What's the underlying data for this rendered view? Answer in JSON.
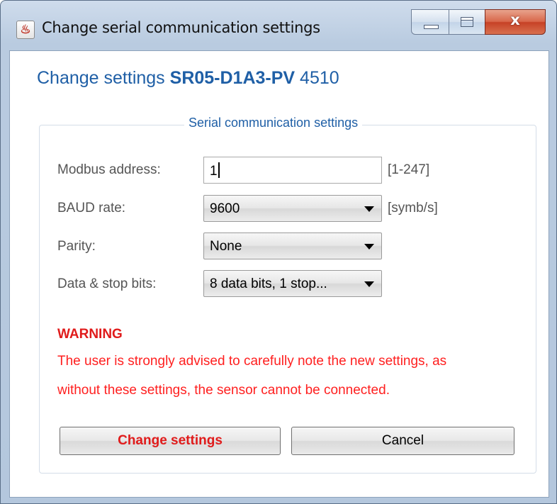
{
  "window": {
    "title": "Change serial communication settings",
    "app_icon": "java-icon",
    "close_glyph": "x",
    "colors": {
      "frame": "#b9cbe0",
      "close": "#c74226"
    }
  },
  "header": {
    "prefix": "Change settings",
    "model": "SR05-D1A3-PV",
    "serial": "4510",
    "color": "#1f5fa6"
  },
  "group": {
    "legend": "Serial communication settings"
  },
  "form": {
    "modbus_address": {
      "label": "Modbus address:",
      "value": "1",
      "range": "[1-247]"
    },
    "baud_rate": {
      "label": "BAUD rate:",
      "value": "9600",
      "unit": "[symb/s]"
    },
    "parity": {
      "label": "Parity:",
      "value": "None"
    },
    "data_stop_bits": {
      "label": "Data & stop bits:",
      "value": "8 data bits, 1 stop..."
    }
  },
  "warning": {
    "title": "WARNING",
    "line1": "The user is strongly advised to carefully note the new settings, as",
    "line2": "without these settings, the sensor cannot be connected.",
    "color": "#ff1f1f"
  },
  "buttons": {
    "change": "Change settings",
    "cancel": "Cancel"
  }
}
